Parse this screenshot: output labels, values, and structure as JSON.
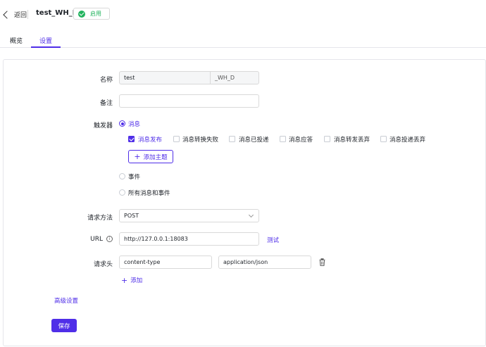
{
  "header": {
    "back_label": "返回",
    "title": "test_WH_D",
    "status_label": "启用",
    "status_color": "#22b35e"
  },
  "tabs": [
    {
      "label": "概览",
      "active": false
    },
    {
      "label": "设置",
      "active": true
    }
  ],
  "accent_color": "#4f2ee8",
  "form": {
    "name": {
      "label": "名称",
      "value": "test",
      "suffix": "_WH_D"
    },
    "remark": {
      "label": "备注",
      "value": ""
    },
    "trigger": {
      "label": "触发器",
      "options": [
        {
          "label": "消息",
          "checked": true
        },
        {
          "label": "事件",
          "checked": false
        },
        {
          "label": "所有消息和事件",
          "checked": false
        }
      ],
      "message_types": [
        {
          "label": "消息发布",
          "checked": true
        },
        {
          "label": "消息转换失败",
          "checked": false
        },
        {
          "label": "消息已投递",
          "checked": false
        },
        {
          "label": "消息应答",
          "checked": false
        },
        {
          "label": "消息转发丢弃",
          "checked": false
        },
        {
          "label": "消息投递丢弃",
          "checked": false
        }
      ],
      "add_topic_label": "添加主题"
    },
    "method": {
      "label": "请求方法",
      "value": "POST"
    },
    "url": {
      "label": "URL",
      "value": "http://127.0.0.1:18083",
      "test_label": "测试"
    },
    "headers": {
      "label": "请求头",
      "rows": [
        {
          "key": "content-type",
          "value": "application/json"
        }
      ],
      "add_label": "添加"
    }
  },
  "advanced_label": "高级设置",
  "save_label": "保存"
}
